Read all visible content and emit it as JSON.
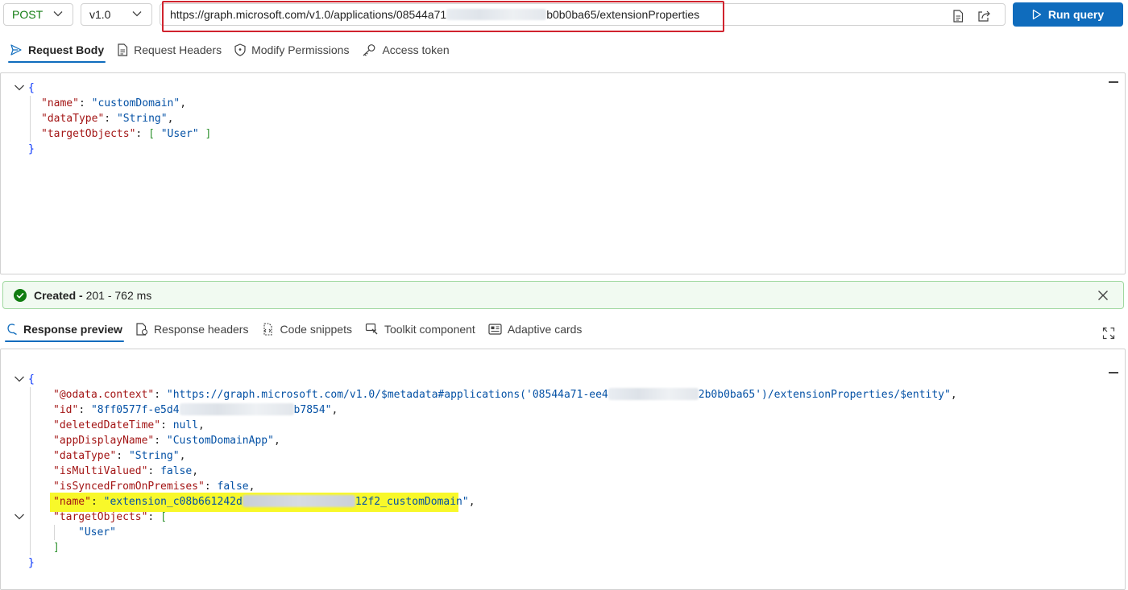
{
  "toolbar": {
    "method": "POST",
    "version": "v1.0",
    "url_prefix": "https://graph.microsoft.com/v1.0/applications/08544a71",
    "url_suffix": "b0b0ba65/extensionProperties",
    "run_label": "Run query"
  },
  "request_tabs": [
    {
      "label": "Request Body",
      "icon": "send-icon",
      "active": true
    },
    {
      "label": "Request Headers",
      "icon": "document-icon"
    },
    {
      "label": "Modify Permissions",
      "icon": "shield-icon"
    },
    {
      "label": "Access token",
      "icon": "key-icon"
    }
  ],
  "request_body": {
    "name_key": "\"name\"",
    "name_val": "\"customDomain\"",
    "datatype_key": "\"dataType\"",
    "datatype_val": "\"String\"",
    "targets_key": "\"targetObjects\"",
    "targets_val": "\"User\""
  },
  "status": {
    "label": "Created -",
    "detail": " 201 - 762 ms",
    "color": "#107c10"
  },
  "response_tabs": [
    {
      "label": "Response preview",
      "icon": "preview-icon",
      "active": true
    },
    {
      "label": "Response headers",
      "icon": "document-icon"
    },
    {
      "label": "Code snippets",
      "icon": "snippet-icon"
    },
    {
      "label": "Toolkit component",
      "icon": "toolkit-icon"
    },
    {
      "label": "Adaptive cards",
      "icon": "card-icon"
    }
  ],
  "response": {
    "context_key": "\"@odata.context\"",
    "context_val_a": "\"https://graph.microsoft.com/v1.0/$metadata#applications('08544a71-ee4",
    "context_val_b": "2b0b0ba65')/extensionProperties/$entity\"",
    "id_key": "\"id\"",
    "id_val_a": "\"8ff0577f-e5d4",
    "id_val_b": "b7854\"",
    "deleted_key": "\"deletedDateTime\"",
    "deleted_val": "null",
    "appname_key": "\"appDisplayName\"",
    "appname_val": "\"CustomDomainApp\"",
    "datatype_key": "\"dataType\"",
    "datatype_val": "\"String\"",
    "multi_key": "\"isMultiValued\"",
    "multi_val": "false",
    "synced_key": "\"isSyncedFromOnPremises\"",
    "synced_val": "false",
    "name_key": "\"name\"",
    "name_val_a": "\"extension_c08b661242d",
    "name_val_b": "12f2_customDomain\"",
    "targets_key": "\"targetObjects\"",
    "targets_item": "\"User\""
  }
}
